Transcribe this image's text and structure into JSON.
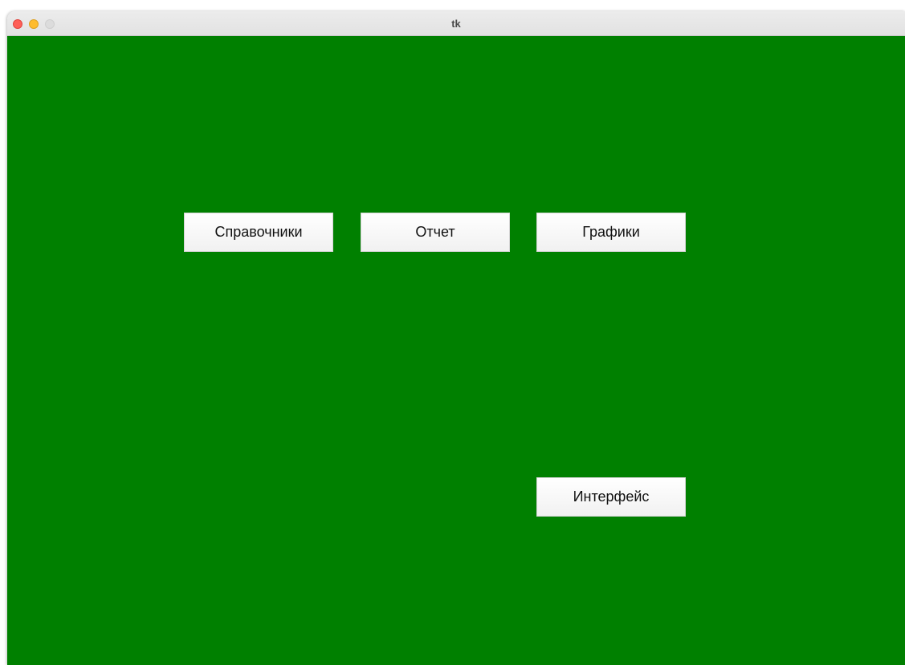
{
  "window": {
    "title": "tk",
    "background_color": "#008000"
  },
  "buttons": {
    "directories": "Справочники",
    "report": "Отчет",
    "charts": "Графики",
    "interface": "Интерфейс"
  },
  "icons": {
    "close": "close-traffic-light",
    "minimize": "minimize-traffic-light",
    "zoom": "zoom-traffic-light"
  }
}
